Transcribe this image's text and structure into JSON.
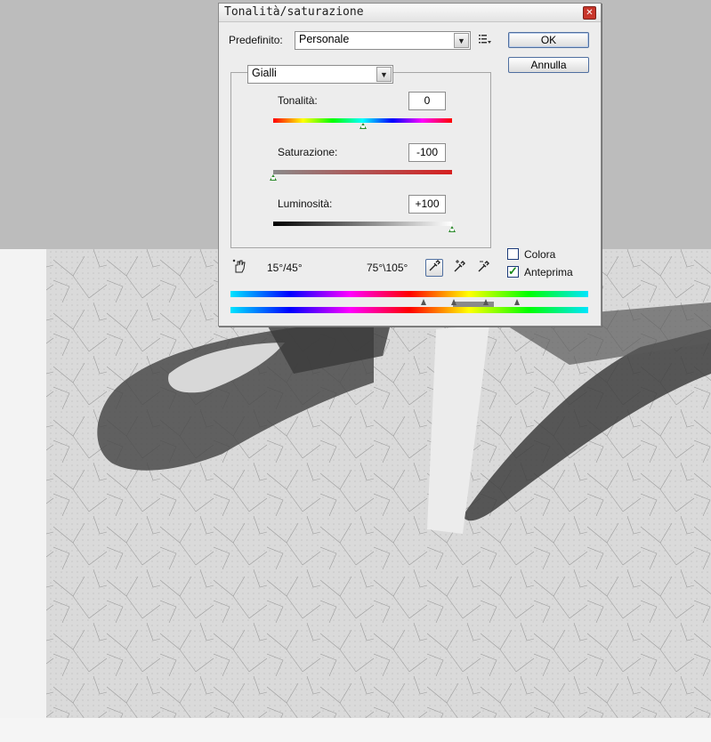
{
  "dialog": {
    "title": "Tonalità/saturazione",
    "close_glyph": "✕",
    "preset_label": "Predefinito:",
    "preset_value": "Personale",
    "preset_menu_icon": "options-menu-icon",
    "ok_label": "OK",
    "cancel_label": "Annulla",
    "channel_value": "Gialli",
    "hue": {
      "label": "Tonalità:",
      "value": "0",
      "level": 0.5
    },
    "saturation": {
      "label": "Saturazione:",
      "value": "-100",
      "level": 0.0
    },
    "lightness": {
      "label": "Luminosità:",
      "value": "+100",
      "level": 1.0
    },
    "colorize": {
      "label": "Colora",
      "checked": false
    },
    "preview": {
      "label": "Anteprima",
      "checked": true
    },
    "range_left": "15°/45°",
    "range_right": "75°\\105°",
    "tools": [
      "hand-adjust-icon",
      "eyedropper-icon",
      "eyedropper-plus-icon",
      "eyedropper-minus-icon"
    ]
  },
  "colors": {
    "dialog_bg": "#ededed",
    "accent_border": "#4f6fa0",
    "thumb_green": "#2a8a2a",
    "close_red": "#c8362b"
  }
}
